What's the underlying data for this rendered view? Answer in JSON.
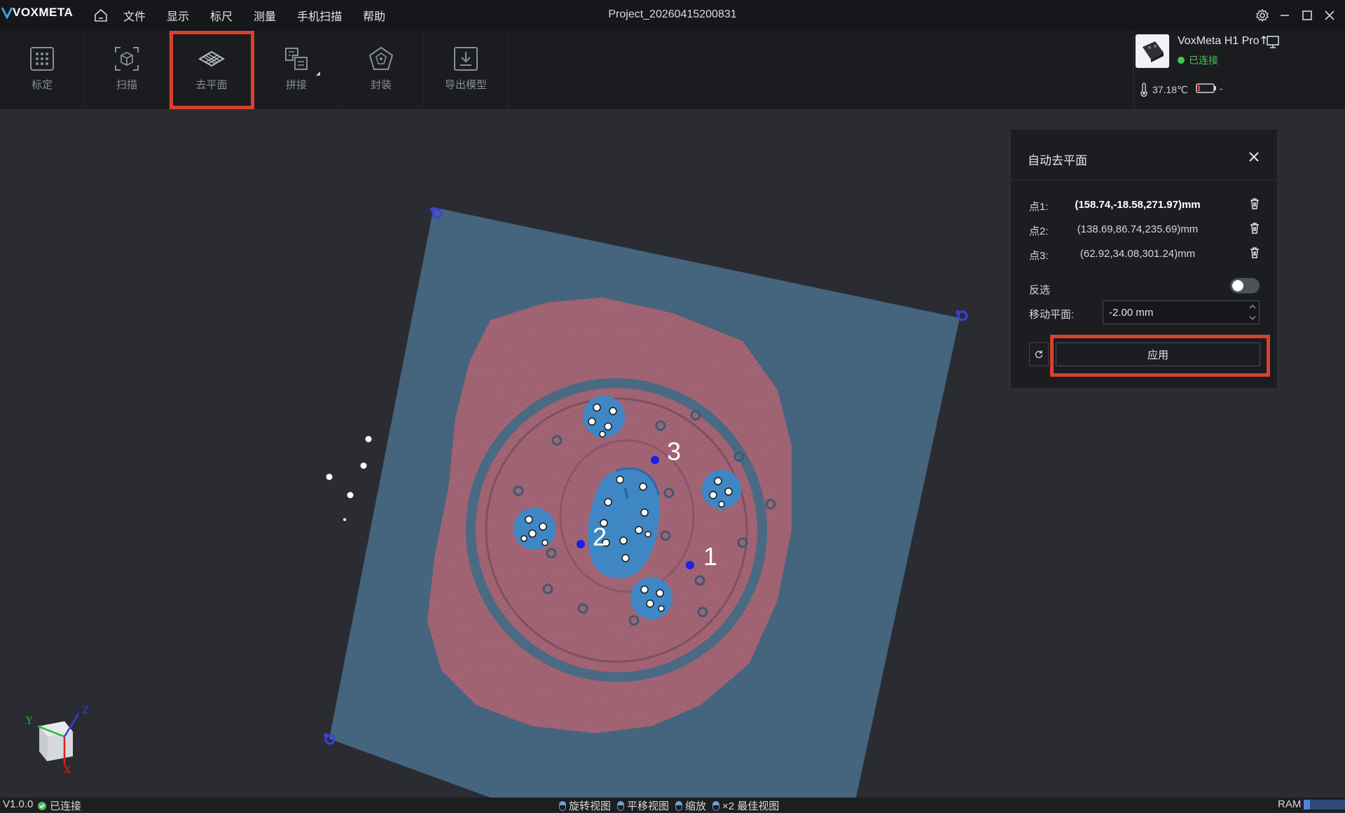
{
  "app": {
    "logo_text": "VOXMETA",
    "project_title": "Project_20260415200831"
  },
  "menu": [
    "文件",
    "显示",
    "标尺",
    "测量",
    "手机扫描",
    "帮助"
  ],
  "toolbar": {
    "tools": [
      {
        "label": "标定",
        "icon": "calibration-grid-icon"
      },
      {
        "label": "扫描",
        "icon": "scan-cube-icon"
      },
      {
        "label": "去平面",
        "icon": "remove-plane-icon",
        "highlighted": true
      },
      {
        "label": "拼接",
        "icon": "stitch-icon"
      },
      {
        "label": "封装",
        "icon": "encapsulate-icon"
      },
      {
        "label": "导出模型",
        "icon": "export-model-icon"
      }
    ]
  },
  "device": {
    "name": "VoxMeta H1 Pro",
    "status": "已连接",
    "temperature": "37.18℃",
    "battery": "-"
  },
  "panel": {
    "title": "自动去平面",
    "points": [
      {
        "label": "点1:",
        "value": "(158.74,-18.58,271.97)mm",
        "active": true
      },
      {
        "label": "点2:",
        "value": "(138.69,86.74,235.69)mm",
        "active": false
      },
      {
        "label": "点3:",
        "value": "(62.92,34.08,301.24)mm",
        "active": false
      }
    ],
    "invert_label": "反选",
    "invert_on": false,
    "move_label": "移动平面:",
    "move_value": "-2.00 mm",
    "apply_label": "应用"
  },
  "scene": {
    "point_markers": [
      "1",
      "2",
      "3"
    ],
    "axis_labels": {
      "x": "X",
      "y": "Y",
      "z": "Z"
    }
  },
  "statusbar": {
    "version": "V1.0.0",
    "connection": "已连接",
    "hints": [
      "旋转视图",
      "平移视图",
      "缩放",
      "×2 最佳视图"
    ],
    "ram_label": "RAM",
    "ram_fraction": 0.15
  },
  "colors": {
    "highlight": "#d9412f",
    "plane": "#45647e",
    "scan_pink": "#a86676",
    "model_blue": "#3f86c4",
    "connected_green": "#4cc25a"
  }
}
